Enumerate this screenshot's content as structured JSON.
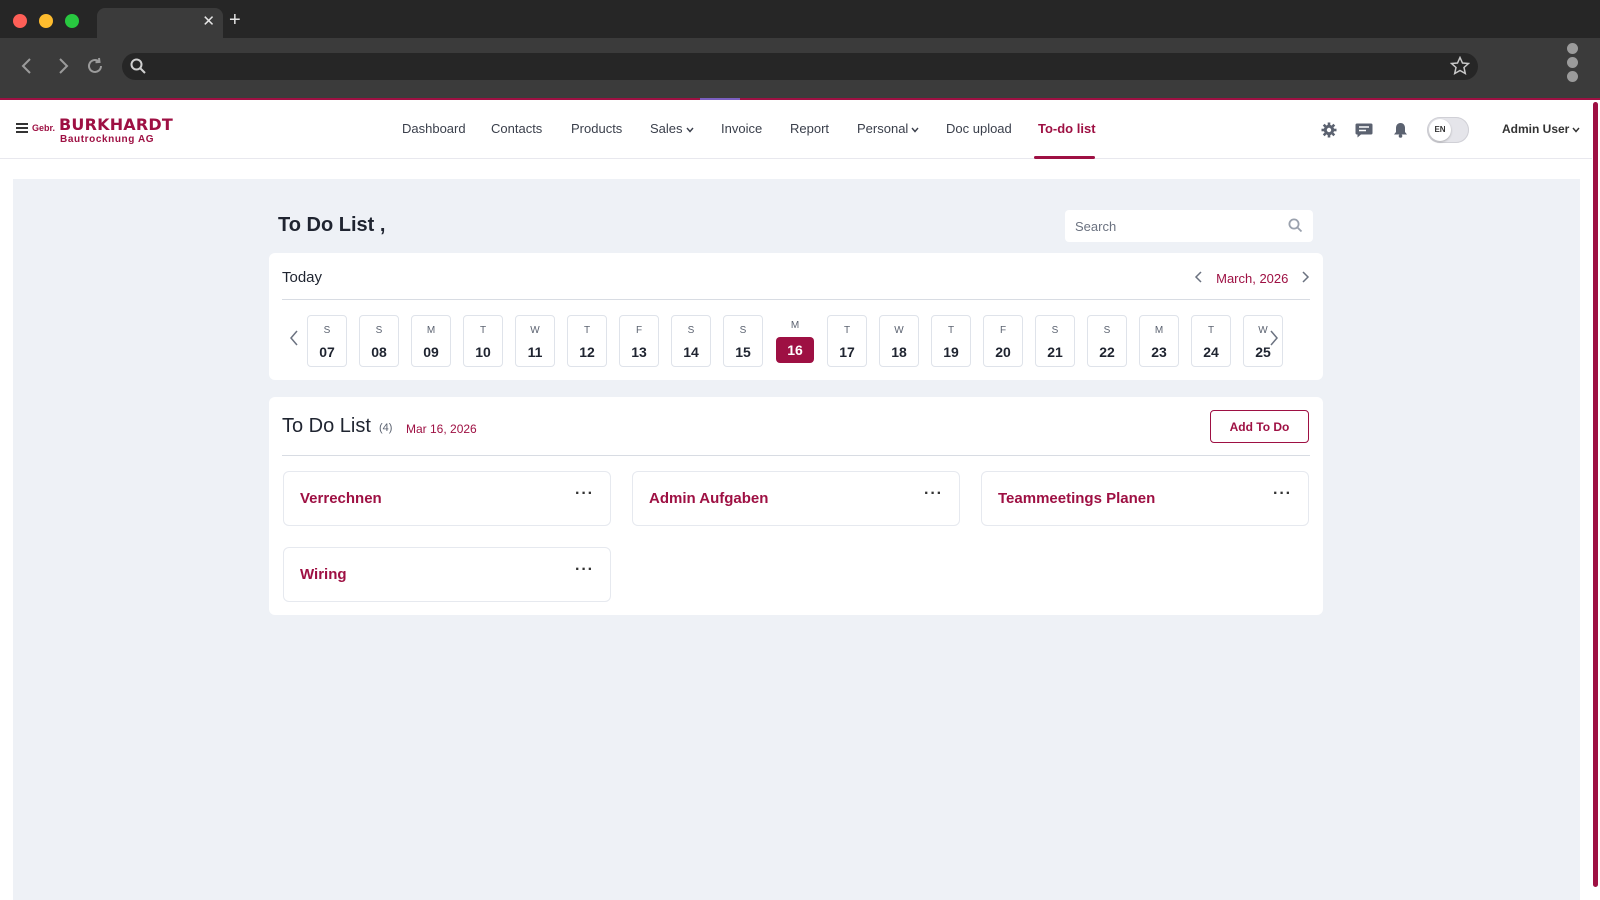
{
  "colors": {
    "brand": "#9e1043",
    "content_bg": "#eef1f6"
  },
  "browser": {
    "tab_close": "✕",
    "new_tab": "+"
  },
  "logo": {
    "prefix": "Gebr.",
    "name": "BURKHARDT",
    "subtitle": "Bautrocknung AG"
  },
  "nav": {
    "items": [
      {
        "label": "Dashboard",
        "dropdown": false,
        "active": false
      },
      {
        "label": "Contacts",
        "dropdown": false,
        "active": false
      },
      {
        "label": "Products",
        "dropdown": false,
        "active": false
      },
      {
        "label": "Sales",
        "dropdown": true,
        "active": false
      },
      {
        "label": "Invoice",
        "dropdown": false,
        "active": false
      },
      {
        "label": "Report",
        "dropdown": false,
        "active": false
      },
      {
        "label": "Personal",
        "dropdown": true,
        "active": false
      },
      {
        "label": "Doc upload",
        "dropdown": false,
        "active": false
      },
      {
        "label": "To-do list",
        "dropdown": false,
        "active": true
      }
    ]
  },
  "header": {
    "icons": [
      "gear-icon",
      "chat-icon",
      "bell-icon"
    ],
    "language": "EN",
    "user": "Admin User"
  },
  "page": {
    "title": "To Do List ,",
    "search_placeholder": "Search"
  },
  "calendar": {
    "today_label": "Today",
    "month_label": "March, 2026",
    "days": [
      {
        "weekday": "S",
        "date": "07"
      },
      {
        "weekday": "S",
        "date": "08"
      },
      {
        "weekday": "M",
        "date": "09"
      },
      {
        "weekday": "T",
        "date": "10"
      },
      {
        "weekday": "W",
        "date": "11"
      },
      {
        "weekday": "T",
        "date": "12"
      },
      {
        "weekday": "F",
        "date": "13"
      },
      {
        "weekday": "S",
        "date": "14"
      },
      {
        "weekday": "S",
        "date": "15"
      },
      {
        "weekday": "M",
        "date": "16",
        "selected": true
      },
      {
        "weekday": "T",
        "date": "17"
      },
      {
        "weekday": "W",
        "date": "18"
      },
      {
        "weekday": "T",
        "date": "19"
      },
      {
        "weekday": "F",
        "date": "20"
      },
      {
        "weekday": "S",
        "date": "21"
      },
      {
        "weekday": "S",
        "date": "22"
      },
      {
        "weekday": "M",
        "date": "23"
      },
      {
        "weekday": "T",
        "date": "24"
      },
      {
        "weekday": "W",
        "date": "25"
      }
    ]
  },
  "todo": {
    "title": "To Do List",
    "count": "(4)",
    "date": "Mar 16, 2026",
    "add_button": "Add To Do",
    "more_label": "···",
    "tasks": [
      {
        "name": "Verrechnen"
      },
      {
        "name": "Admin Aufgaben"
      },
      {
        "name": "Teammeetings Planen"
      },
      {
        "name": "Wiring"
      }
    ]
  }
}
